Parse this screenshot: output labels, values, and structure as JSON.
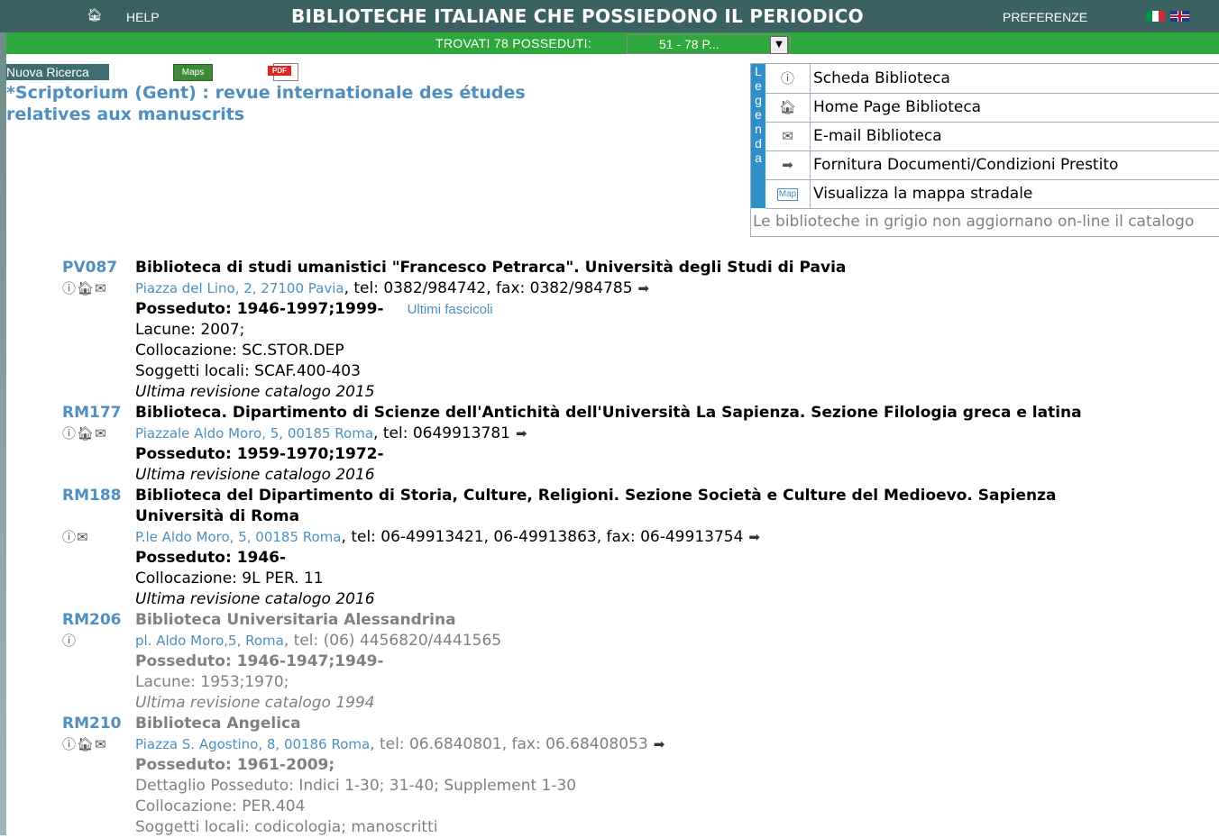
{
  "topbar": {
    "help_label": "HELP",
    "title": "BIBLIOTECHE ITALIANE CHE POSSIEDONO IL PERIODICO",
    "preferences_label": "PREFERENZE"
  },
  "greenbar": {
    "found_label": "TROVATI 78 POSSEDUTI:",
    "range_value": "51 - 78 P..."
  },
  "actions": {
    "new_search": "Nuova Ricerca",
    "maps_label": "Maps",
    "pdf_label": "PDF"
  },
  "journal_title": "*Scriptorium (Gent) : revue internationale des études relatives aux manuscrits",
  "legend": {
    "letters": [
      "L",
      "e",
      "g",
      "e",
      "n",
      "d",
      "a"
    ],
    "items": [
      {
        "icon": "info-icon",
        "label": "Scheda Biblioteca"
      },
      {
        "icon": "home-icon",
        "label": "Home Page Biblioteca"
      },
      {
        "icon": "mail-icon",
        "label": "E-mail Biblioteca"
      },
      {
        "icon": "forward-icon",
        "label": "Fornitura Documenti/Condizioni Prestito"
      },
      {
        "icon": "map-icon",
        "label": "Visualizza la mappa stradale"
      }
    ],
    "map_icon_text": "Map",
    "note": "Le biblioteche in grigio non aggiornano on-line il catalogo"
  },
  "libraries": [
    {
      "code": "PV087",
      "name": "Biblioteca di studi umanistici \"Francesco Petrarca\". Università degli Studi di Pavia",
      "address": "Piazza del Lino, 2, 27100 Pavia",
      "contacts": ", tel: 0382/984742, fax: 0382/984785",
      "holdings": "Posseduto: 1946-1997;1999-",
      "latest": "Ultimi fascicoli",
      "lacune": "Lacune: 2007;",
      "collocazione": "Collocazione: SC.STOR.DEP",
      "soggetti": "Soggetti locali: SCAF.400-403",
      "revision": "Ultima revisione catalogo 2015"
    },
    {
      "code": "RM177",
      "name": "Biblioteca. Dipartimento di Scienze dell'Antichità dell'Università La Sapienza. Sezione Filologia greca e latina",
      "address": "Piazzale Aldo Moro, 5, 00185 Roma",
      "contacts": ", tel: 0649913781",
      "holdings": "Posseduto: 1959-1970;1972-",
      "revision": "Ultima revisione catalogo 2016"
    },
    {
      "code": "RM188",
      "name_line1": "Biblioteca del Dipartimento di Storia, Culture, Religioni. Sezione Società e Culture del Medioevo. Sapienza",
      "name_line2": "Università di Roma",
      "address": "P.le Aldo Moro, 5, 00185 Roma",
      "contacts": ", tel: 06-49913421, 06-49913863, fax: 06-49913754",
      "holdings": "Posseduto: 1946-",
      "collocazione": "Collocazione: 9L PER. 11",
      "revision": "Ultima revisione catalogo 2016"
    },
    {
      "code": "RM206",
      "name": "Biblioteca Universitaria Alessandrina",
      "address": "pl. Aldo Moro,5, Roma",
      "contacts": ", tel: (06) 4456820/4441565",
      "holdings": "Posseduto: 1946-1947;1949-",
      "lacune": "Lacune: 1953;1970;",
      "revision": "Ultima revisione catalogo 1994"
    },
    {
      "code": "RM210",
      "name": "Biblioteca Angelica",
      "address": "Piazza S. Agostino, 8, 00186 Roma",
      "contacts": ", tel: 06.6840801, fax: 06.68408053",
      "holdings": "Posseduto: 1961-2009;",
      "dettaglio": "Dettaglio Posseduto: Indici 1-30; 31-40; Supplement 1-30",
      "collocazione": "Collocazione: PER.404",
      "soggetti": "Soggetti locali: codicologia; manoscritti"
    }
  ]
}
